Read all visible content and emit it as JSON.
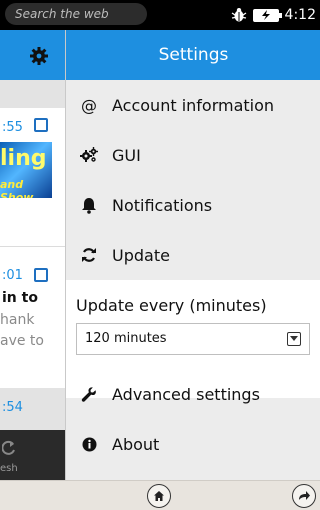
{
  "status_bar": {
    "search_placeholder": "Search the web",
    "time": "4:12",
    "icons": [
      "bug-icon",
      "battery-charging-icon"
    ]
  },
  "background_list": {
    "items": [
      {
        "time": ":55",
        "thumb_text_1": "ling",
        "thumb_text_2": "and Show"
      },
      {
        "time": ":01",
        "title": "in to",
        "lines": [
          "hank",
          "ave to"
        ]
      }
    ],
    "footer_time": ":54",
    "toolbar_label": "esh"
  },
  "settings": {
    "title": "Settings",
    "menu": [
      {
        "id": "account",
        "label": "Account information",
        "icon": "at-icon"
      },
      {
        "id": "gui",
        "label": "GUI",
        "icon": "gears-icon"
      },
      {
        "id": "notifications",
        "label": "Notifications",
        "icon": "bell-icon"
      },
      {
        "id": "update",
        "label": "Update",
        "icon": "refresh-icon"
      }
    ],
    "update_panel": {
      "label": "Update every (minutes)",
      "selected": "120 minutes"
    },
    "menu_bottom": [
      {
        "id": "advanced",
        "label": "Advanced settings",
        "icon": "wrench-icon"
      },
      {
        "id": "about",
        "label": "About",
        "icon": "info-icon"
      }
    ]
  },
  "colors": {
    "header_blue": "#1e8fe0",
    "drawer_bg": "#ececec",
    "status_bar": "#000000"
  }
}
